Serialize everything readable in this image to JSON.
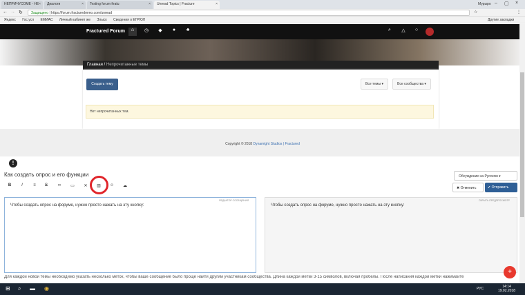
{
  "browser": {
    "tabs": [
      {
        "label": "НЕПРИЧУСОМЕ - НЕ"
      },
      {
        "label": "Диалоги"
      },
      {
        "label": "Testing forum featu"
      },
      {
        "label": "Unread Topics | Fracture"
      }
    ],
    "user": "Мурыро",
    "secure_label": "Защищено",
    "url": "https://forum.fracturedmmo.com/unread",
    "bookmarks": [
      "Яндекс",
      "Гос.усл",
      "ЕМИАС",
      "Личный кабинет же",
      "Злыск",
      "Сведения о ЕГРЮЛ"
    ],
    "other_bookmarks": "Другие закладки"
  },
  "site": {
    "brand": "Fractured Forum",
    "breadcrumb_home": "Главная",
    "breadcrumb_sep": "/",
    "breadcrumb_current": "Непрочитанные темы",
    "create_topic": "Создать тему",
    "all_topics": "Все темы ▾",
    "all_communities": "Все сообщества ▾",
    "no_unread": "Нет непрочитанных тем.",
    "copyright": "Copyright © 2018",
    "studio_link": "Dynamight Studios | Fractured"
  },
  "editor": {
    "title": "Как создать опрос и его функции",
    "lang_button": "Обсуждение на Русском ▾",
    "cancel": "✖ Отменить",
    "send": "✔ Отправить",
    "tooltip": "Создать опрос",
    "text": "Чтобы создать опрос на форуме, нужно просто нажать на эту кнопку:",
    "editor_label": "РЕДАКТОР СООБЩЕНИЙ",
    "preview_label": "СКРЫТЬ ПРЕДПРОСМОТР",
    "hint": "Для каждой новой темы необходимо указать несколько меток, чтобы ваше сообщение было проще найти другим участникам сообщества. Длина каждой метки 3-15 символов, включая пробелы. После написания каждой метки нажимайте"
  },
  "taskbar": {
    "time": "14:14",
    "date": "19.02.2018",
    "lang": "РУС"
  },
  "colors": {
    "accent_red": "#e0252b",
    "nav_bg": "#111111",
    "primary_blue": "#3a5f8c"
  }
}
